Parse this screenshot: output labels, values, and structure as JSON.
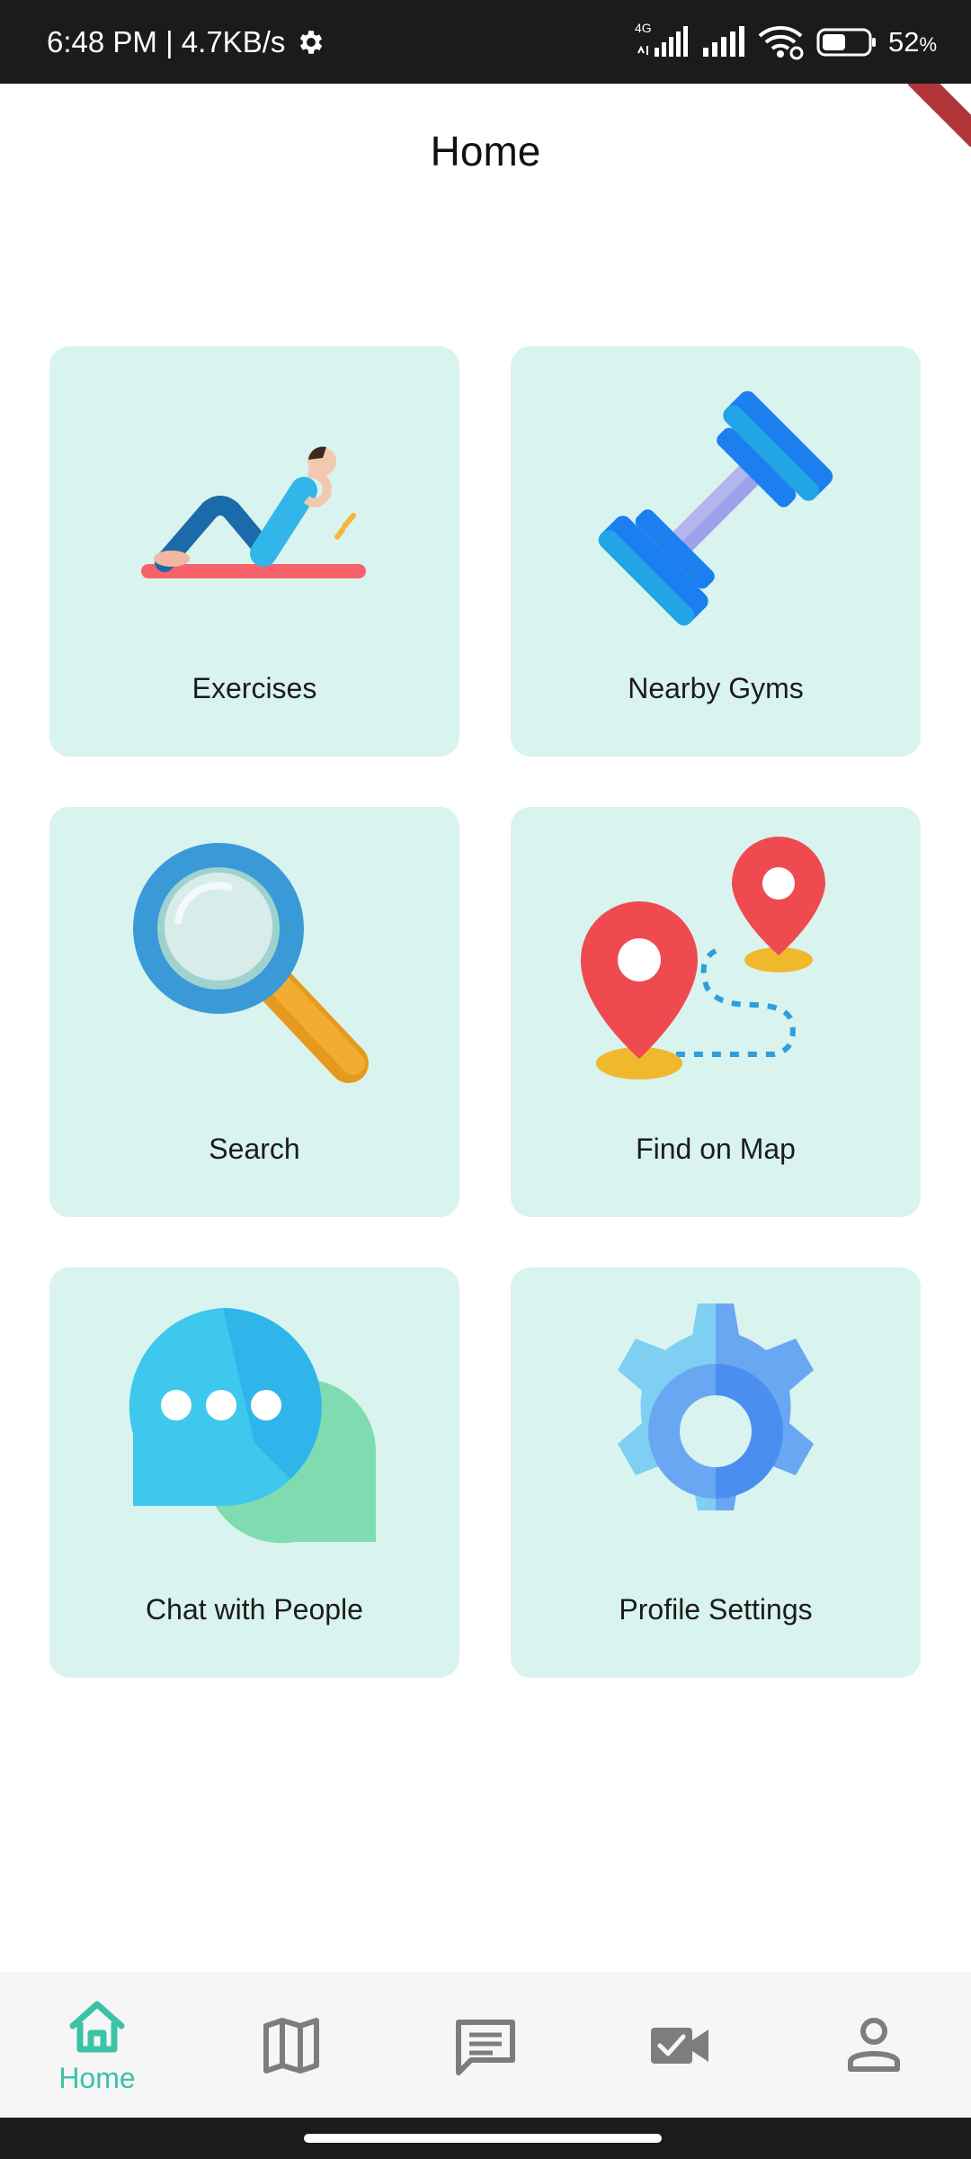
{
  "status_bar": {
    "time_speed": "6:48 PM | 4.7KB/s",
    "network_type": "4G",
    "battery": "52",
    "battery_unit": "%",
    "battery_level": 0.52
  },
  "header": {
    "title": "Home"
  },
  "cards": [
    {
      "label": "Exercises",
      "icon": "exercise-icon"
    },
    {
      "label": "Nearby Gyms",
      "icon": "dumbbell-icon"
    },
    {
      "label": "Search",
      "icon": "magnifier-icon"
    },
    {
      "label": "Find on Map",
      "icon": "map-pins-icon"
    },
    {
      "label": "Chat with People",
      "icon": "chat-bubbles-icon"
    },
    {
      "label": "Profile Settings",
      "icon": "gear-icon"
    }
  ],
  "bottom_nav": {
    "active": "home",
    "items": [
      {
        "id": "home",
        "label": "Home",
        "icon": "home-icon"
      },
      {
        "id": "map",
        "icon": "map-icon"
      },
      {
        "id": "chat",
        "icon": "message-icon"
      },
      {
        "id": "video",
        "icon": "video-call-icon"
      },
      {
        "id": "profile",
        "icon": "person-icon"
      }
    ]
  },
  "colors": {
    "card_background": "#d9f3ee",
    "accent": "#3cc2a6",
    "inactive_icon": "#7d7d7d"
  }
}
